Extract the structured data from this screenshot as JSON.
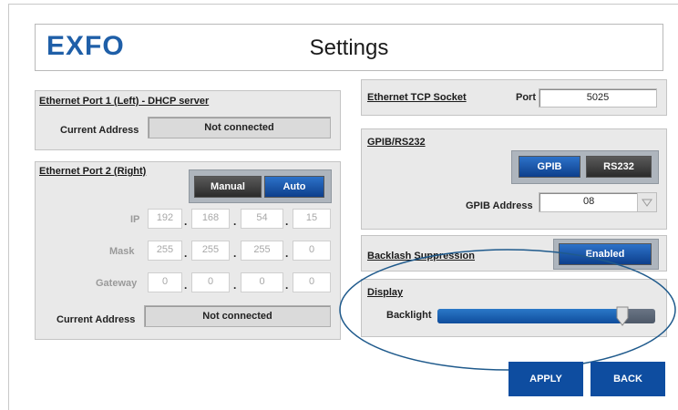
{
  "header": {
    "logo_text": "EXFO",
    "title": "Settings"
  },
  "eth1": {
    "title": "Ethernet Port 1 (Left) - DHCP server",
    "current_address_label": "Current Address",
    "current_address_value": "Not connected"
  },
  "eth2": {
    "title": "Ethernet Port 2 (Right)",
    "mode_options": [
      "Manual",
      "Auto"
    ],
    "mode_selected": "Auto",
    "ip_label": "IP",
    "ip": [
      "192",
      "168",
      "54",
      "15"
    ],
    "mask_label": "Mask",
    "mask": [
      "255",
      "255",
      "255",
      "0"
    ],
    "gateway_label": "Gateway",
    "gateway": [
      "0",
      "0",
      "0",
      "0"
    ],
    "current_address_label": "Current Address",
    "current_address_value": "Not connected"
  },
  "tcp": {
    "title": "Ethernet TCP Socket",
    "port_label": "Port",
    "port_value": "5025"
  },
  "gpib": {
    "title": "GPIB/RS232",
    "options": [
      "GPIB",
      "RS232"
    ],
    "selected": "GPIB",
    "address_label": "GPIB Address",
    "address_value": "08"
  },
  "backlash": {
    "title": "Backlash Suppression",
    "state": "Enabled"
  },
  "display": {
    "title": "Display",
    "backlight_label": "Backlight",
    "backlight_level": 0.85
  },
  "actions": {
    "apply": "APPLY",
    "back": "BACK"
  },
  "colors": {
    "accent_blue": "#0e4da0",
    "annotation_ellipse": "#1f5a8c"
  }
}
